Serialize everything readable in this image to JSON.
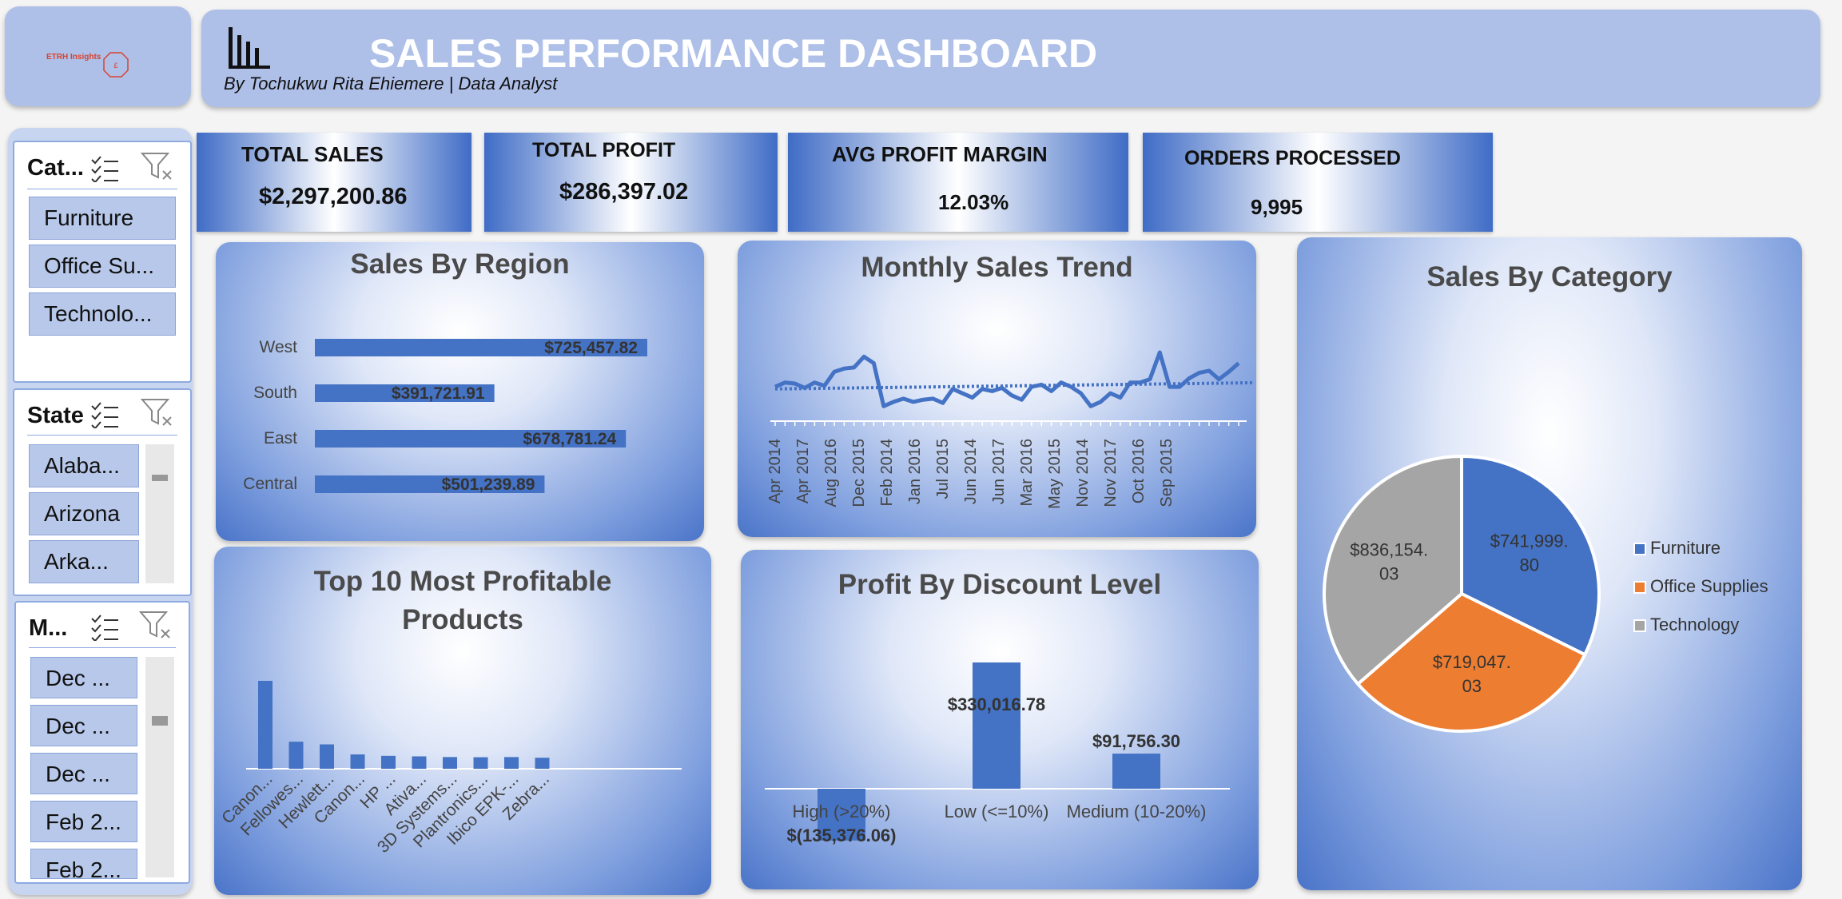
{
  "header": {
    "logo_text": "ETRH Insights",
    "title": "SALES PERFORMANCE DASHBOARD",
    "subtitle": "By Tochukwu Rita Ehiemere | Data Analyst"
  },
  "kpis": [
    {
      "label": "TOTAL SALES",
      "value": "$2,297,200.86"
    },
    {
      "label": "TOTAL PROFIT",
      "value": "$286,397.02"
    },
    {
      "label": "AVG PROFIT MARGIN",
      "value": "12.03%"
    },
    {
      "label": "ORDERS PROCESSED",
      "value": "9,995"
    }
  ],
  "slicers": {
    "category": {
      "title": "Cat...",
      "items": [
        "Furniture",
        "Office Su...",
        "Technolo..."
      ]
    },
    "state": {
      "title": "State",
      "items": [
        "Alaba...",
        "Arizona",
        "Arka..."
      ]
    },
    "month": {
      "title": "M...",
      "items": [
        "Dec ...",
        "Dec ...",
        "Dec ...",
        "Feb 2...",
        "Feb 2..."
      ]
    }
  },
  "chart_data": [
    {
      "type": "bar",
      "orientation": "horizontal",
      "title": "Sales By Region",
      "categories": [
        "West",
        "South",
        "East",
        "Central"
      ],
      "values": [
        725457.82,
        391721.91,
        678781.24,
        501239.89
      ],
      "data_labels": [
        "$725,457.82",
        "$391,721.91",
        "$678,781.24",
        "$501,239.89"
      ],
      "color": "#4472c4"
    },
    {
      "type": "line",
      "title": "Monthly Sales Trend",
      "x_tick_labels": [
        "Apr 2014",
        "Apr 2017",
        "Aug 2016",
        "Dec 2015",
        "Feb 2014",
        "Jan 2016",
        "Jul 2015",
        "Jun 2014",
        "Jun 2017",
        "Mar 2016",
        "May 2015",
        "Nov 2014",
        "Nov 2017",
        "Oct 2016",
        "Sep 2015"
      ],
      "values": [
        20,
        24,
        23,
        19,
        24,
        21,
        34,
        37,
        38,
        48,
        42,
        2,
        6,
        9,
        6,
        8,
        9,
        5,
        18,
        14,
        10,
        18,
        16,
        19,
        12,
        8,
        20,
        22,
        16,
        24,
        20,
        14,
        2,
        6,
        14,
        10,
        24,
        24,
        27,
        52,
        20,
        20,
        28,
        33,
        35,
        27,
        34,
        42
      ],
      "trendline": "linear (dotted)",
      "color": "#4472c4"
    },
    {
      "type": "pie",
      "title": "Sales By Category",
      "labels": [
        "Furniture",
        "Office Supplies",
        "Technology"
      ],
      "values": [
        741999.8,
        719047.03,
        836154.03
      ],
      "data_labels": [
        "$741,999.\n80",
        "$719,047.\n03",
        "$836,154.\n03"
      ],
      "colors": [
        "#4472c4",
        "#ed7d31",
        "#a5a5a5"
      ],
      "legend": "right"
    },
    {
      "type": "bar",
      "title": "Top 10 Most Profitable Products",
      "categories": [
        "Canon...",
        "Fellowes...",
        "Hewlett...",
        "Canon...",
        "HP ...",
        "Ativa...",
        "3D Systems...",
        "Plantronics...",
        "Ibico EPK-...",
        "Zebra..."
      ],
      "values": [
        25200,
        7750,
        6980,
        4100,
        3700,
        3550,
        3350,
        3300,
        3350,
        3150
      ],
      "color": "#4472c4"
    },
    {
      "type": "bar",
      "title": "Profit By Discount Level",
      "categories": [
        "High (>20%)",
        "Low (<=10%)",
        "Medium (10-20%)"
      ],
      "values": [
        -135376.06,
        330016.78,
        91756.3
      ],
      "data_labels": [
        "$(135,376.06)",
        "$330,016.78",
        "$91,756.30"
      ],
      "color": "#4472c4"
    }
  ]
}
